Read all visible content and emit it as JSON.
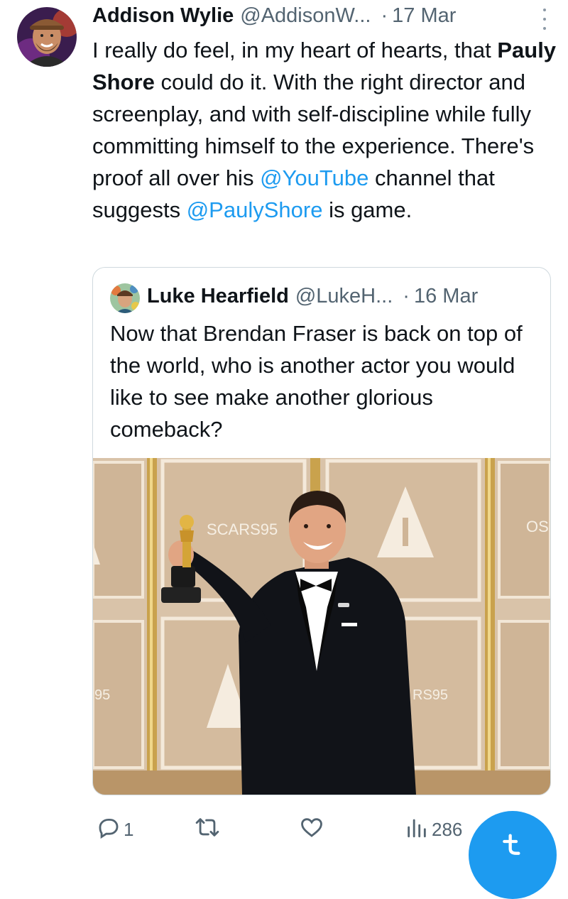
{
  "tweet": {
    "author_name": "Addison Wylie",
    "author_handle": "@AddisonW...",
    "separator": "·",
    "date": "17 Mar",
    "text_part1": "I really do feel, in my heart of hearts, that ",
    "text_bold": "Pauly Shore",
    "text_part2": " could do it. With the right director and screenplay, and with self-discipline while fully committing himself to the experience. There's proof all over his ",
    "mention1": "@YouTube",
    "text_part3": " channel that suggests ",
    "mention2": "@PaulyShore",
    "text_part4": " is game."
  },
  "quoted_tweet": {
    "author_name": "Luke Hearfield",
    "author_handle": "@LukeH...",
    "separator": "·",
    "date": "16 Mar",
    "text": "Now that Brendan Fraser is back on top of the world, who is another actor you would like to see make another glorious  comeback?",
    "photo_texts": {
      "backdrop_1": "SCARS95",
      "backdrop_2": "OS",
      "backdrop_3": "95",
      "backdrop_4": "RS95"
    }
  },
  "actions": {
    "reply_count": "1",
    "views_count": "286",
    "icons": [
      "reply-icon",
      "retweet-icon",
      "like-icon",
      "views-icon",
      "compose-icon"
    ]
  },
  "colors": {
    "accent": "#1d9bf0",
    "text": "#0f1419",
    "secondary": "#536471",
    "border": "#cfd9de"
  }
}
